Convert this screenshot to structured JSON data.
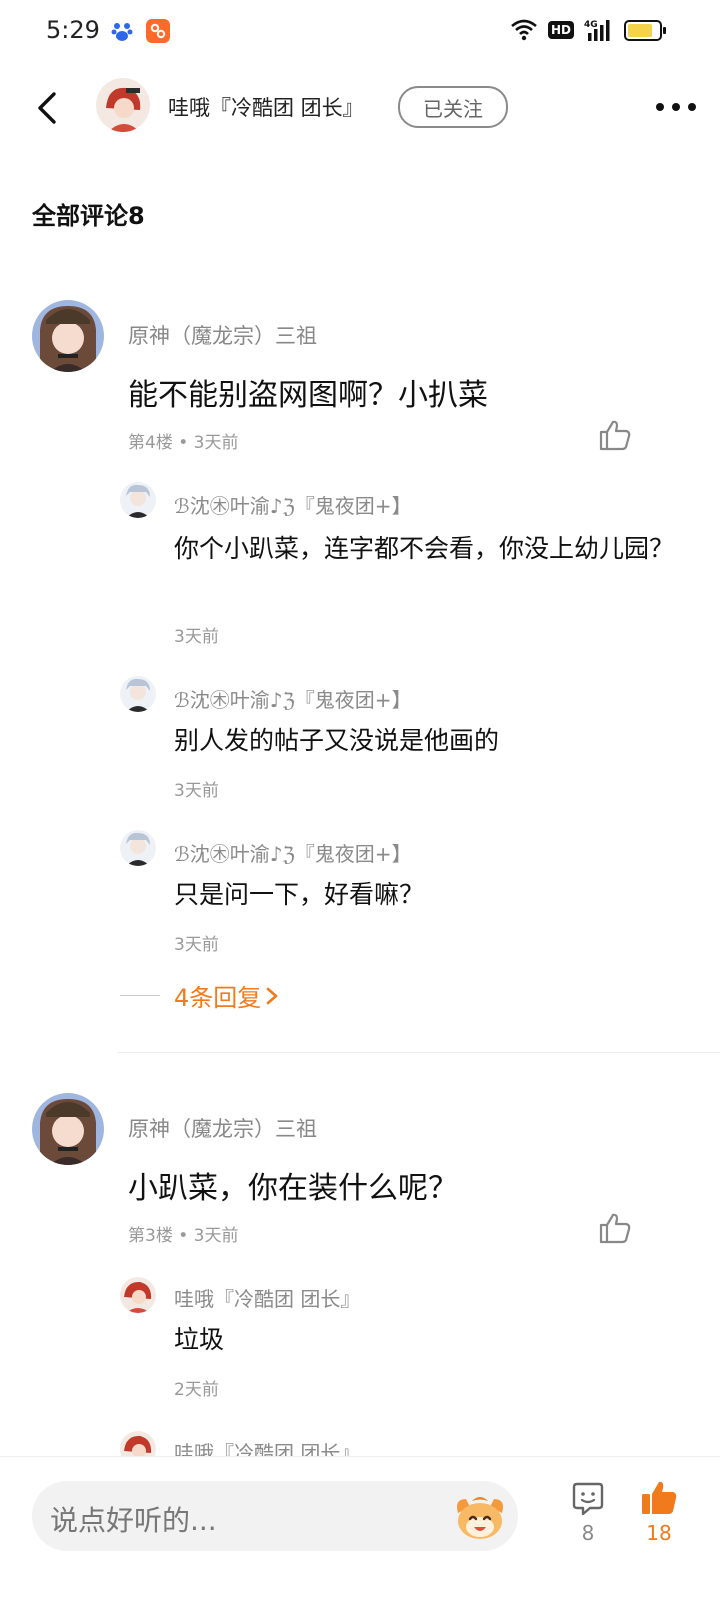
{
  "status_bar": {
    "time": "5:29",
    "hd": "HD",
    "network": "4G"
  },
  "header": {
    "name": "哇哦『冷酷团 团长』",
    "follow_label": "已关注"
  },
  "section_title": "全部评论8",
  "comments": [
    {
      "name": "原神（魔龙宗）三祖",
      "text": "能不能别盗网图啊？小扒菜",
      "meta": "第4楼 • 3天前",
      "replies": [
        {
          "name": "ℬ沈㊍叶渝♪ℨ『鬼夜团+】",
          "text": "你个小趴菜，连字都不会看，你没上幼儿园？",
          "time": "3天前"
        },
        {
          "name": "ℬ沈㊍叶渝♪ℨ『鬼夜团+】",
          "text": "别人发的帖子又没说是他画的",
          "time": "3天前"
        },
        {
          "name": "ℬ沈㊍叶渝♪ℨ『鬼夜团+】",
          "text": "只是问一下，好看嘛？",
          "time": "3天前"
        }
      ],
      "more_replies": "4条回复"
    },
    {
      "name": "原神（魔龙宗）三祖",
      "text": "小趴菜，你在装什么呢？",
      "meta": "第3楼 • 3天前",
      "replies": [
        {
          "name": "哇哦『冷酷团 团长』",
          "text": "垃圾",
          "time": "2天前"
        },
        {
          "name": "哇哦『冷酷团 团长』"
        }
      ]
    }
  ],
  "bottom_bar": {
    "input_placeholder": "说点好听的...",
    "comment_count": "8",
    "like_count": "18"
  },
  "colors": {
    "accent": "#f07a1c",
    "text_secondary": "#888888"
  }
}
